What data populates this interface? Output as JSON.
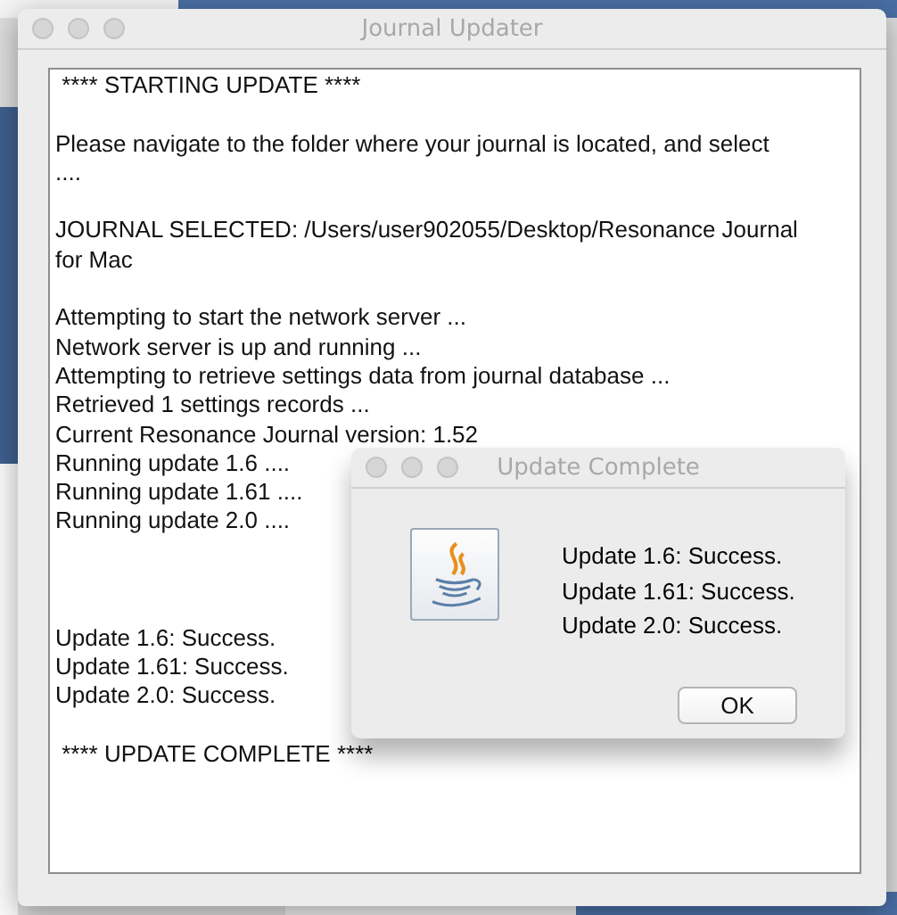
{
  "window": {
    "title": "Journal Updater"
  },
  "log": [
    {
      "kind": "banner",
      "lines": [
        " **** STARTING UPDATE ****"
      ]
    },
    {
      "kind": "prompt",
      "lines": [
        "Please navigate to the folder where your journal is located, and select",
        "...."
      ]
    },
    {
      "kind": "selection",
      "lines": [
        "JOURNAL SELECTED: /Users/user902055/Desktop/Resonance Journal",
        "for Mac"
      ]
    },
    {
      "kind": "progress",
      "lines": [
        "Attempting to start the network server ...",
        "Network server is up and running ...",
        "Attempting to retrieve settings data from journal database ...",
        "Retrieved 1 settings records ...",
        "Current Resonance Journal version: 1.52",
        "Running update 1.6 ....",
        "Running update 1.61 ....",
        "Running update 2.0 ...."
      ]
    },
    {
      "kind": "results",
      "lines": [
        "Update 1.6: Success.",
        "Update 1.61: Success.",
        "Update 2.0: Success."
      ]
    },
    {
      "kind": "banner",
      "lines": [
        " **** UPDATE COMPLETE ****"
      ]
    }
  ],
  "dialog": {
    "title": "Update Complete",
    "messages": [
      "Update 1.6: Success.",
      "Update 1.61: Success.",
      "Update 2.0: Success."
    ],
    "button": "OK"
  }
}
